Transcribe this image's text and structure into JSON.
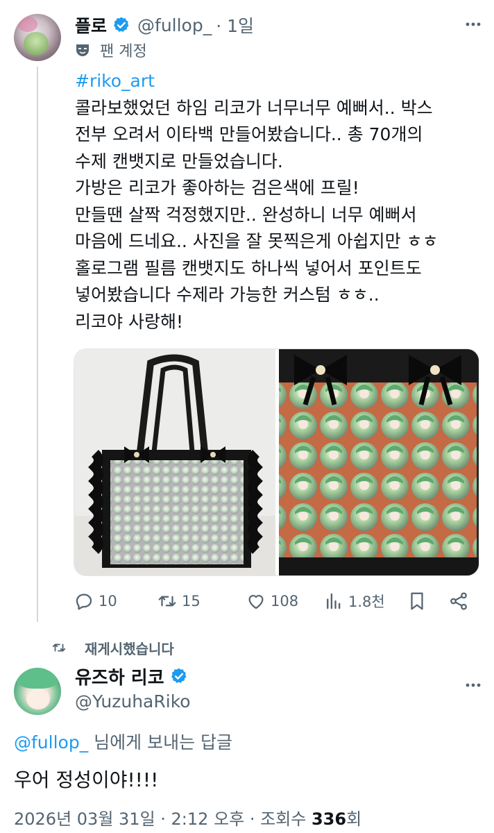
{
  "tweet": {
    "author_name": "플로",
    "author_handle": "@fullop_",
    "time": "· 1일",
    "badge_label": "팬 계정",
    "hashtag": "#riko_art",
    "lines": [
      "콜라보했었던 하임 리코가 너무너무 예뻐서.. 박스",
      "전부 오려서 이타백 만들어봤습니다.. 총 70개의",
      "수제 캔뱃지로 만들었습니다.",
      "가방은 리코가 좋아하는 검은색에 프릴!",
      "만들땐 살짝 걱정했지만..  완성하니 너무 예뻐서",
      "마음에 드네요.. 사진을 잘 못찍은게 아쉽지만 ㅎㅎ",
      "홀로그램 필름 캔뱃지도 하나씩 넣어서 포인트도",
      "넣어봤습니다 수제라 가능한 커스텀 ㅎㅎ..",
      "리코야 사랑해!"
    ],
    "stats": {
      "replies": "10",
      "retweets": "15",
      "likes": "108",
      "views": "1.8천"
    }
  },
  "retweet_label": "재게시했습니다",
  "reply": {
    "author_name": "유즈하 리코",
    "author_handle": "@YuzuhaRiko",
    "reply_to_handle": "@fullop_",
    "reply_to_suffix": " 님에게 보내는 답글",
    "text": "우어 정성이야!!!!",
    "timestamp": "2026년 03월 31일 · 2:12 오후 · 조회수 ",
    "views_count": "336",
    "views_unit": "회"
  },
  "colors": {
    "link": "#1d9bf0",
    "secondary_text": "#536471",
    "verified": "#1d9bf0"
  }
}
